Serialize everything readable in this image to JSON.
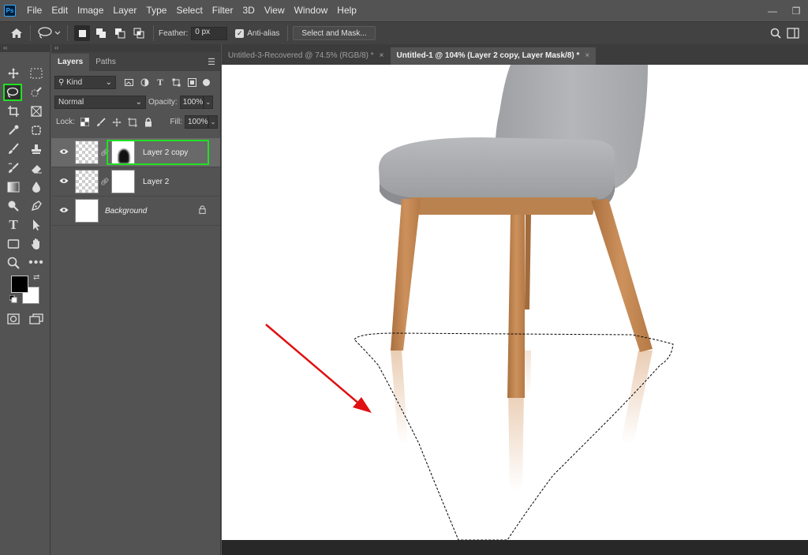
{
  "app": {
    "logo_text": "Ps",
    "menu": [
      "File",
      "Edit",
      "Image",
      "Layer",
      "Type",
      "Select",
      "Filter",
      "3D",
      "View",
      "Window",
      "Help"
    ],
    "window_controls": [
      "—",
      "❐"
    ]
  },
  "options": {
    "feather_label": "Feather:",
    "feather_value": "0 px",
    "antialias_label": "Anti-alias",
    "antialias_checked": true,
    "select_mask_button": "Select and Mask..."
  },
  "tools": {
    "active": "lasso",
    "collapse_label": "‹‹"
  },
  "layers_panel": {
    "collapse_label": "‹‹",
    "tabs": [
      {
        "label": "Layers",
        "active": true
      },
      {
        "label": "Paths",
        "active": false
      }
    ],
    "filter_kind": "Kind",
    "blend_mode": "Normal",
    "opacity_label": "Opacity:",
    "opacity_value": "100%",
    "lock_label": "Lock:",
    "fill_label": "Fill:",
    "fill_value": "100%",
    "layers": [
      {
        "name": "Layer 2 copy",
        "selected": true,
        "has_mask": true,
        "highlighted": true
      },
      {
        "name": "Layer 2",
        "selected": false,
        "has_mask": true
      },
      {
        "name": "Background",
        "selected": false,
        "locked": true
      }
    ]
  },
  "documents": {
    "tabs": [
      {
        "title": "Untitled-3-Recovered @ 74.5% (RGB/8) *",
        "active": false,
        "close": "×"
      },
      {
        "title": "Untitled-1 @ 104% (Layer 2 copy, Layer Mask/8) *",
        "active": true,
        "close": "×"
      }
    ]
  },
  "colors": {
    "selection_highlight": "#22e022",
    "arrow": "#e01010",
    "chair_fabric": "#a9aaad",
    "chair_wood": "#c0834f"
  }
}
